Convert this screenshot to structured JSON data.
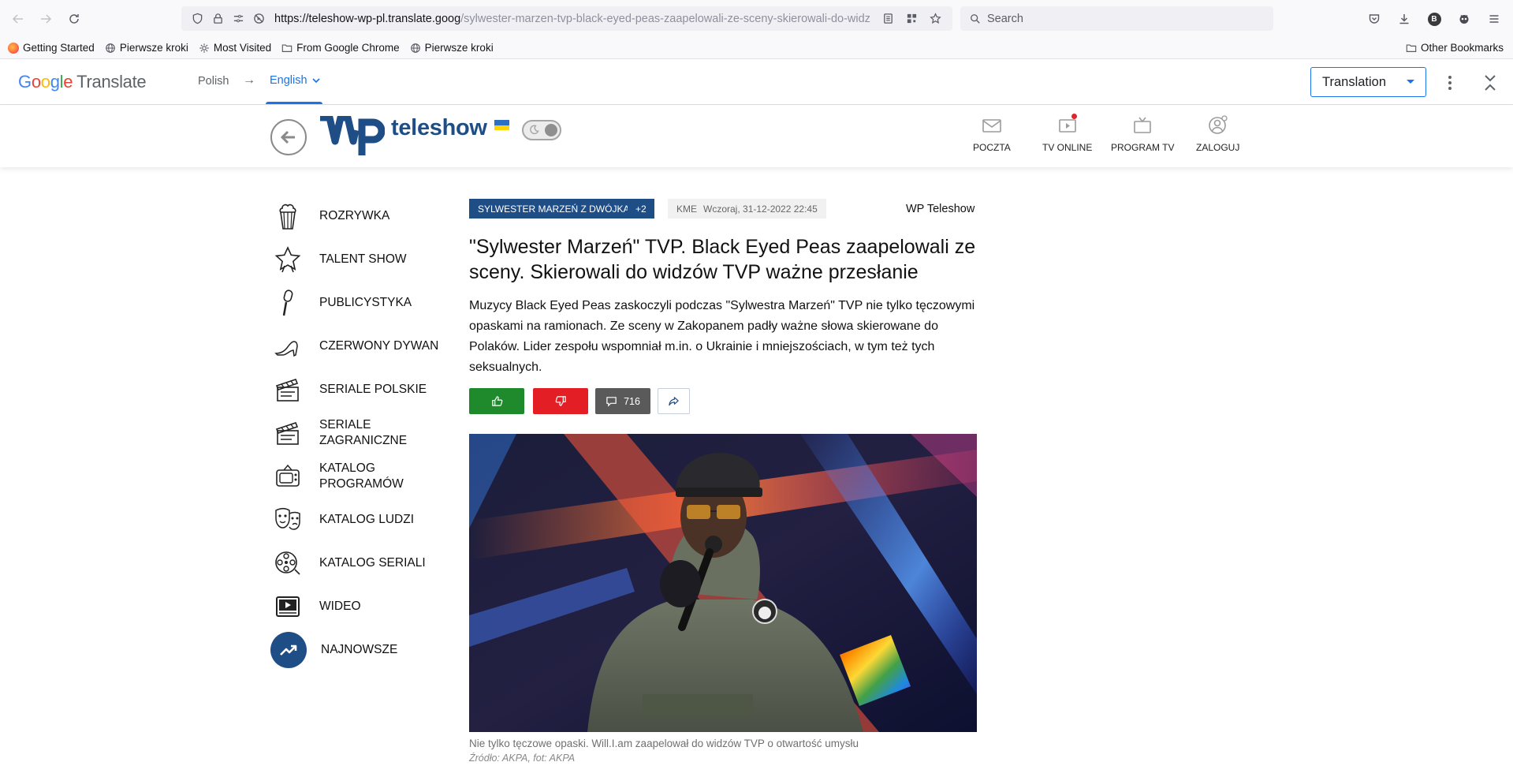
{
  "browser": {
    "url_host": "https://teleshow-wp-pl.translate.goog",
    "url_path": "/sylwester-marzen-tvp-black-eyed-peas-zaapelowali-ze-sceny-skierowali-do-widz",
    "search_placeholder": "Search",
    "profile_initial": "B",
    "bookmarks": [
      "Getting Started",
      "Pierwsze kroki",
      "Most Visited",
      "From Google Chrome",
      "Pierwsze kroki"
    ],
    "other_bookmarks": "Other Bookmarks"
  },
  "translate_bar": {
    "logo_word": [
      "G",
      "o",
      "o",
      "g",
      "l",
      "e"
    ],
    "logo_suffix": "Translate",
    "source_lang": "Polish",
    "arrow": "→",
    "target_lang": "English",
    "mode": "Translation"
  },
  "site_header": {
    "brand": "teleshow",
    "nav": [
      {
        "label": "POCZTA",
        "icon": "envelope-icon"
      },
      {
        "label": "TV ONLINE",
        "icon": "tv-play-icon"
      },
      {
        "label": "PROGRAM TV",
        "icon": "tv-icon"
      },
      {
        "label": "ZALOGUJ",
        "icon": "user-icon"
      }
    ]
  },
  "sidebar": {
    "items": [
      {
        "label": "ROZRYWKA",
        "icon": "popcorn-icon"
      },
      {
        "label": "TALENT SHOW",
        "icon": "star-icon"
      },
      {
        "label": "PUBLICYSTYKA",
        "icon": "microphone-icon"
      },
      {
        "label": "CZERWONY DYWAN",
        "icon": "high-heel-icon"
      },
      {
        "label": "SERIALE POLSKIE",
        "icon": "clapperboard-icon"
      },
      {
        "label": "SERIALE ZAGRANICZNE",
        "icon": "clapperboard-icon"
      },
      {
        "label": "KATALOG PROGRAMÓW",
        "icon": "retro-tv-icon"
      },
      {
        "label": "KATALOG LUDZI",
        "icon": "masks-icon"
      },
      {
        "label": "KATALOG SERIALI",
        "icon": "film-reel-icon"
      },
      {
        "label": "WIDEO",
        "icon": "video-icon"
      },
      {
        "label": "NAJNOWSZE",
        "icon": "trending-icon"
      }
    ]
  },
  "article": {
    "tag_primary": "SYLWESTER MARZEŃ Z DWÓJKĄ",
    "tag_more": "+2",
    "author": "KME",
    "date": "Wczoraj, 31-12-2022 22:45",
    "source": "WP Teleshow",
    "title": "\"Sylwester Marzeń\" TVP. Black Eyed Peas zaapelowali ze sceny. Skierowali do widzów TVP ważne przesłanie",
    "lead": "Muzycy Black Eyed Peas zaskoczyli podczas \"Sylwestra Marzeń\" TVP nie tylko tęczowymi opaskami na ramionach. Ze sceny w Zakopanem padły ważne słowa skierowane do Polaków. Lider zespołu wspomniał m.in. o Ukrainie i mniejszościach, w tym też tych seksualnych.",
    "comments_count": "716",
    "caption": "Nie tylko tęczowe opaski. Will.I.am zaapelował do widzów TVP o otwartość umysłu",
    "credit": "Źródło: AKPA, fot: AKPA"
  },
  "colors": {
    "wp_blue": "#1f4e87",
    "like_green": "#1e8a2c",
    "dislike_red": "#e31e24",
    "gt_blue": "#1a73e8"
  }
}
